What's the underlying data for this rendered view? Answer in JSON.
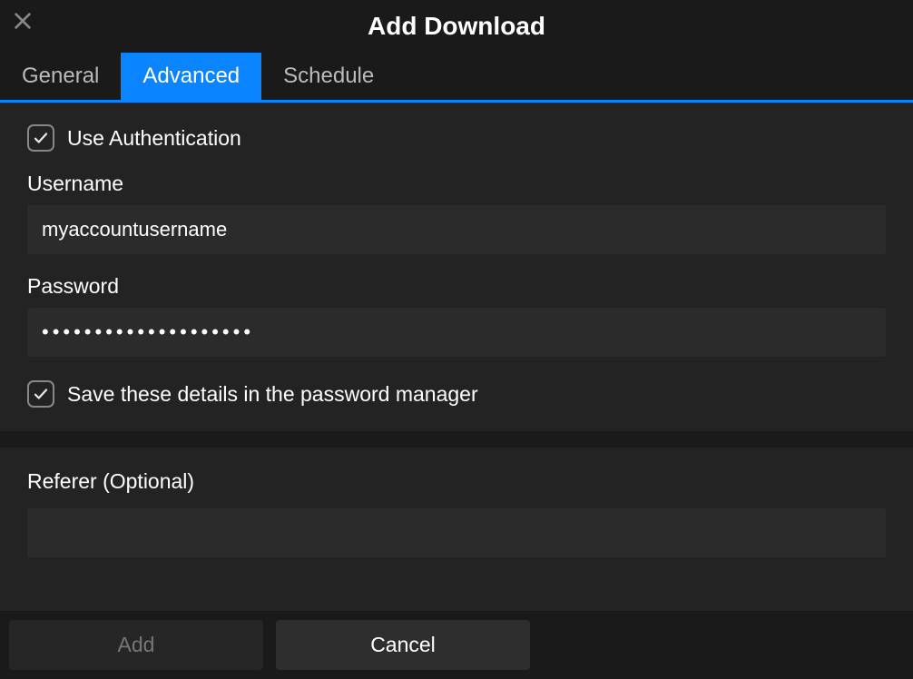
{
  "dialog": {
    "title": "Add Download"
  },
  "tabs": {
    "general": "General",
    "advanced": "Advanced",
    "schedule": "Schedule",
    "active": "advanced"
  },
  "auth": {
    "use_auth_label": "Use Authentication",
    "use_auth_checked": true,
    "username_label": "Username",
    "username_value": "myaccountusername",
    "password_label": "Password",
    "password_value": "••••••••••••••••••••",
    "save_label": "Save these details in the password manager",
    "save_checked": true
  },
  "referer": {
    "label": "Referer (Optional)",
    "value": ""
  },
  "buttons": {
    "add": "Add",
    "cancel": "Cancel"
  }
}
